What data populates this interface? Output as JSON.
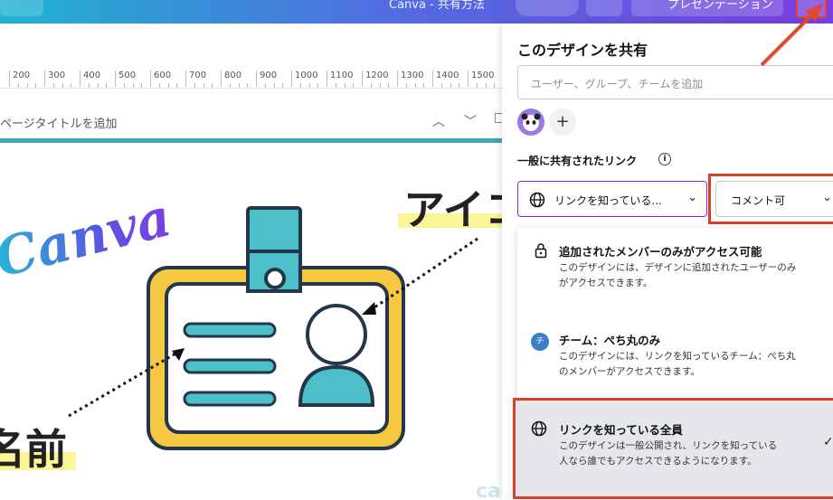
{
  "topbar": {
    "title": "Canva - 共有方法",
    "present_label": "プレゼンテーション"
  },
  "ruler": {
    "ticks": [
      "200",
      "300",
      "400",
      "500",
      "600",
      "700",
      "800",
      "900",
      "1000",
      "1100",
      "1200",
      "1300",
      "1400",
      "1500"
    ]
  },
  "page": {
    "title_placeholder": "ページタイトルを追加"
  },
  "canvas": {
    "logo_text": "Canva",
    "label_icon": "アイコ",
    "label_name": "名前",
    "watermark": "ca"
  },
  "share_panel": {
    "title": "このデザインを共有",
    "search_placeholder": "ユーザー、グループ、チームを追加",
    "link_section_label": "一般に共有されたリンク",
    "access_value": "リンクを知っている...",
    "permission_value": "コメント可",
    "options": [
      {
        "title": "追加されたメンバーのみがアクセス可能",
        "desc_line1": "このデザインには、デザインに追加されたユーザーのみ",
        "desc_line2": "がアクセスできます。",
        "icon": "lock-icon"
      },
      {
        "title": "チーム：ぺち丸のみ",
        "desc_line1": "このデザインには、リンクを知っているチーム：ぺち丸",
        "desc_line2": "のメンバーがアクセスできます。",
        "icon": "team-badge-icon",
        "badge": "チ"
      },
      {
        "title": "リンクを知っている全員",
        "desc_line1": "このデザインは一般公開され、リンクを知っている",
        "desc_line2": "人なら誰でもアクセスできるようになります。",
        "icon": "globe-icon",
        "selected": true
      }
    ]
  },
  "colors": {
    "accent_purple": "#7d2ae8",
    "highlight_red": "#d8402a",
    "teal": "#4dbfc9",
    "yellow": "#f6c842",
    "navy": "#23364a"
  }
}
